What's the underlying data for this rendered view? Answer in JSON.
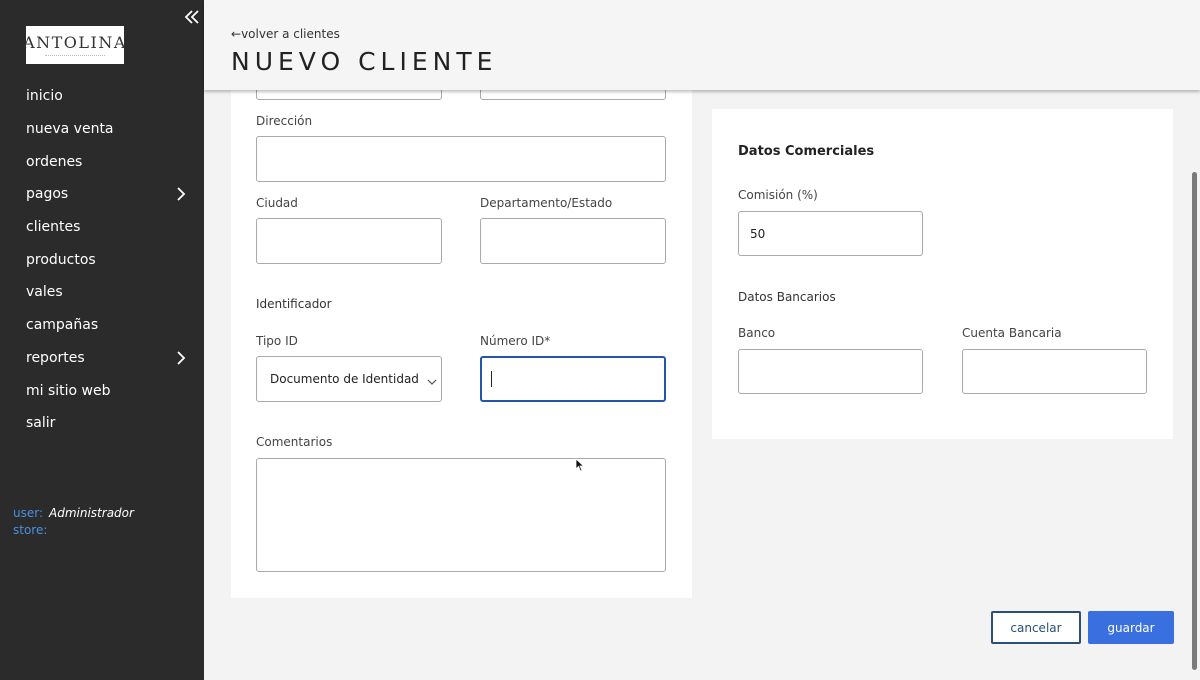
{
  "sidebar": {
    "logo": "ANTOLINA",
    "items": [
      {
        "label": "inicio"
      },
      {
        "label": "nueva venta"
      },
      {
        "label": "ordenes"
      },
      {
        "label": "pagos"
      },
      {
        "label": "clientes"
      },
      {
        "label": "productos"
      },
      {
        "label": "vales"
      },
      {
        "label": "campañas"
      },
      {
        "label": "reportes"
      },
      {
        "label": "mi sitio web"
      },
      {
        "label": "salir"
      }
    ],
    "user_key": "user:",
    "user_value": "Administrador",
    "store_key": "store:",
    "store_value": ""
  },
  "header": {
    "back_link": "volver a clientes",
    "back_arrow": "←",
    "title": "NUEVO CLIENTE"
  },
  "form_left": {
    "direccion_label": "Dirección",
    "direccion_value": "",
    "ciudad_label": "Ciudad",
    "ciudad_value": "",
    "departamento_label": "Departamento/Estado",
    "departamento_value": "",
    "identificador_label": "Identificador",
    "tipo_id_label": "Tipo ID",
    "tipo_id_value": "Documento de Identidad",
    "numero_id_label": "Número ID*",
    "numero_id_value": "",
    "comentarios_label": "Comentarios",
    "comentarios_value": ""
  },
  "form_right": {
    "title": "Datos Comerciales",
    "comision_label": "Comisión (%)",
    "comision_value": "50",
    "bancarios_label": "Datos Bancarios",
    "banco_label": "Banco",
    "banco_value": "",
    "cuenta_label": "Cuenta Bancaria",
    "cuenta_value": ""
  },
  "actions": {
    "cancel_label": "cancelar",
    "save_label": "guardar"
  },
  "colors": {
    "sidebar_bg": "#2b2b2b",
    "accent": "#3a6fe0",
    "focus_border": "#2356a8",
    "user_key": "#4a90e2"
  }
}
